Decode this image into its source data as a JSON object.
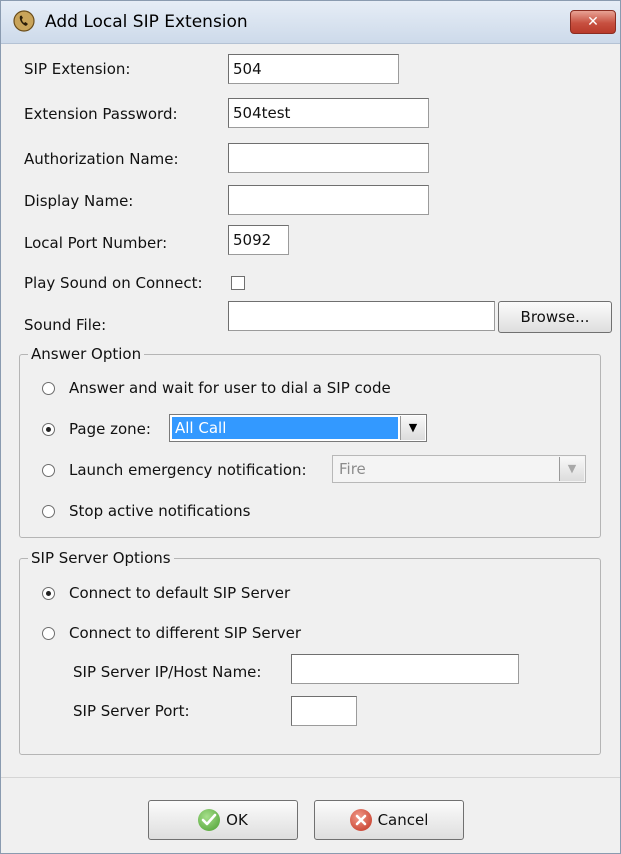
{
  "window": {
    "title": "Add Local SIP Extension",
    "close_glyph": "✕",
    "app_icon": "sip-phone-icon"
  },
  "form": {
    "sip_extension": {
      "label": "SIP Extension:",
      "value": "504"
    },
    "extension_password": {
      "label": "Extension Password:",
      "value": "504test"
    },
    "authorization_name": {
      "label": "Authorization Name:",
      "value": ""
    },
    "display_name": {
      "label": "Display Name:",
      "value": ""
    },
    "local_port": {
      "label": "Local Port Number:",
      "value": "5092"
    },
    "play_sound": {
      "label": "Play Sound on Connect:",
      "checked": false
    },
    "sound_file": {
      "label": "Sound File:",
      "value": "",
      "browse_label": "Browse..."
    }
  },
  "answer_option": {
    "legend": "Answer Option",
    "options": [
      {
        "label": "Answer and wait for user to dial a SIP code",
        "selected": false
      },
      {
        "label": "Page zone:",
        "selected": true,
        "select_value": "All Call"
      },
      {
        "label": "Launch emergency notification:",
        "selected": false,
        "select_value": "Fire",
        "disabled": true
      },
      {
        "label": "Stop active notifications",
        "selected": false
      }
    ]
  },
  "sip_server_options": {
    "legend": "SIP Server Options",
    "options": [
      {
        "label": "Connect to default SIP Server",
        "selected": true
      },
      {
        "label": "Connect to different SIP Server",
        "selected": false
      }
    ],
    "host_label": "SIP Server IP/Host Name:",
    "host_value": "",
    "port_label": "SIP Server Port:",
    "port_value": ""
  },
  "buttons": {
    "ok_label": "OK",
    "cancel_label": "Cancel"
  },
  "colors": {
    "selection": "#3399ff",
    "close_button": "#c75040",
    "ok_icon": "#4a9d2f",
    "cancel_icon": "#c0301e"
  }
}
